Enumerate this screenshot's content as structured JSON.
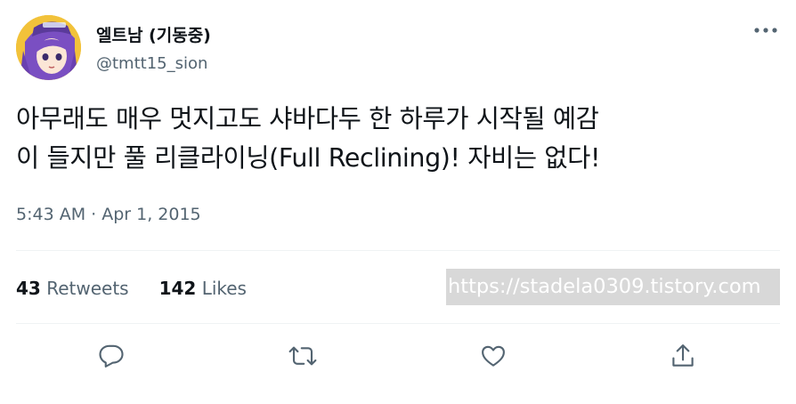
{
  "author": {
    "display_name": "엘트남 (기동중)",
    "handle": "@tmtt15_sion",
    "avatar_icon": "anime-avatar"
  },
  "tweet": {
    "text_lines": [
      "아무래도 매우 멋지고도 샤바다두 한 하루가 시작될 예감",
      "이 들지만 풀 리클라이닝(Full Reclining)! 자비는 없다!"
    ],
    "timestamp": "5:43 AM · Apr 1, 2015"
  },
  "stats": {
    "retweets_count": "43",
    "retweets_label": "Retweets",
    "likes_count": "142",
    "likes_label": "Likes"
  },
  "watermark": "https://stadela0309.tistory.com",
  "colors": {
    "text_primary": "#0f1419",
    "text_secondary": "#536471",
    "divider": "#eff3f4",
    "icon": "#536471"
  },
  "icons": {
    "more": "more-horizontal-icon",
    "reply": "reply-icon",
    "retweet": "retweet-icon",
    "like": "like-icon",
    "share": "share-icon"
  }
}
